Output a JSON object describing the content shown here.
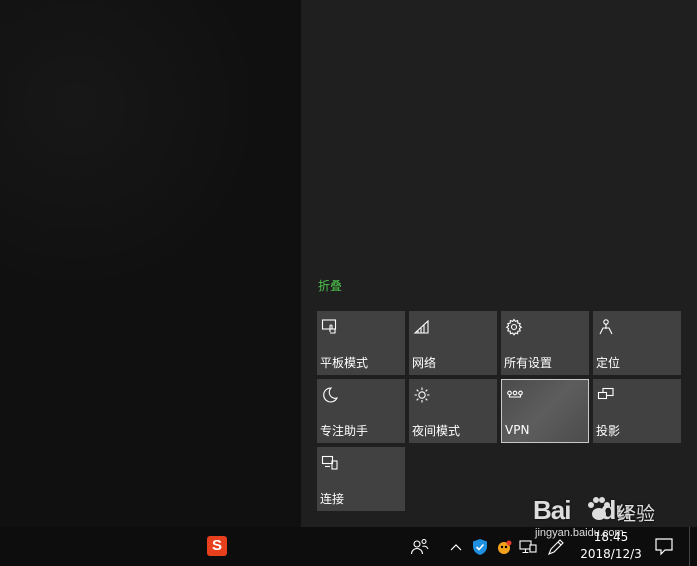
{
  "action_center": {
    "collapse_label": "折叠",
    "tiles": [
      {
        "label": "平板模式",
        "icon": "tablet-mode-icon",
        "active": false
      },
      {
        "label": "网络",
        "icon": "network-icon",
        "active": false
      },
      {
        "label": "所有设置",
        "icon": "gear-icon",
        "active": false
      },
      {
        "label": "定位",
        "icon": "location-icon",
        "active": false
      },
      {
        "label": "专注助手",
        "icon": "moon-icon",
        "active": false
      },
      {
        "label": "夜间模式",
        "icon": "brightness-icon",
        "active": false
      },
      {
        "label": "VPN",
        "icon": "vpn-icon",
        "active": true
      },
      {
        "label": "投影",
        "icon": "project-icon",
        "active": false
      },
      {
        "label": "连接",
        "icon": "connect-icon",
        "active": false
      }
    ]
  },
  "taskbar": {
    "pinned_app_icon": "sogou-input-icon",
    "pinned_app_glyph": "S",
    "tray_icons": [
      "people-icon",
      "chevron-up-icon",
      "shield-icon",
      "app-tray-icon",
      "network-icon",
      "pen-icon"
    ],
    "clock_time": "18:45",
    "clock_date": "2018/12/3",
    "notification_icon": "notification-icon"
  },
  "watermark": {
    "logo_text": "Bai",
    "logo_suffix": "du",
    "chinese_text": "经验",
    "url_text": "jingyan.baidu.com"
  },
  "colors": {
    "accent_green": "#4cc24c",
    "tile_background": "#414141",
    "panel_background": "#1f1f1f",
    "taskbar_background": "#0d0d0d"
  }
}
